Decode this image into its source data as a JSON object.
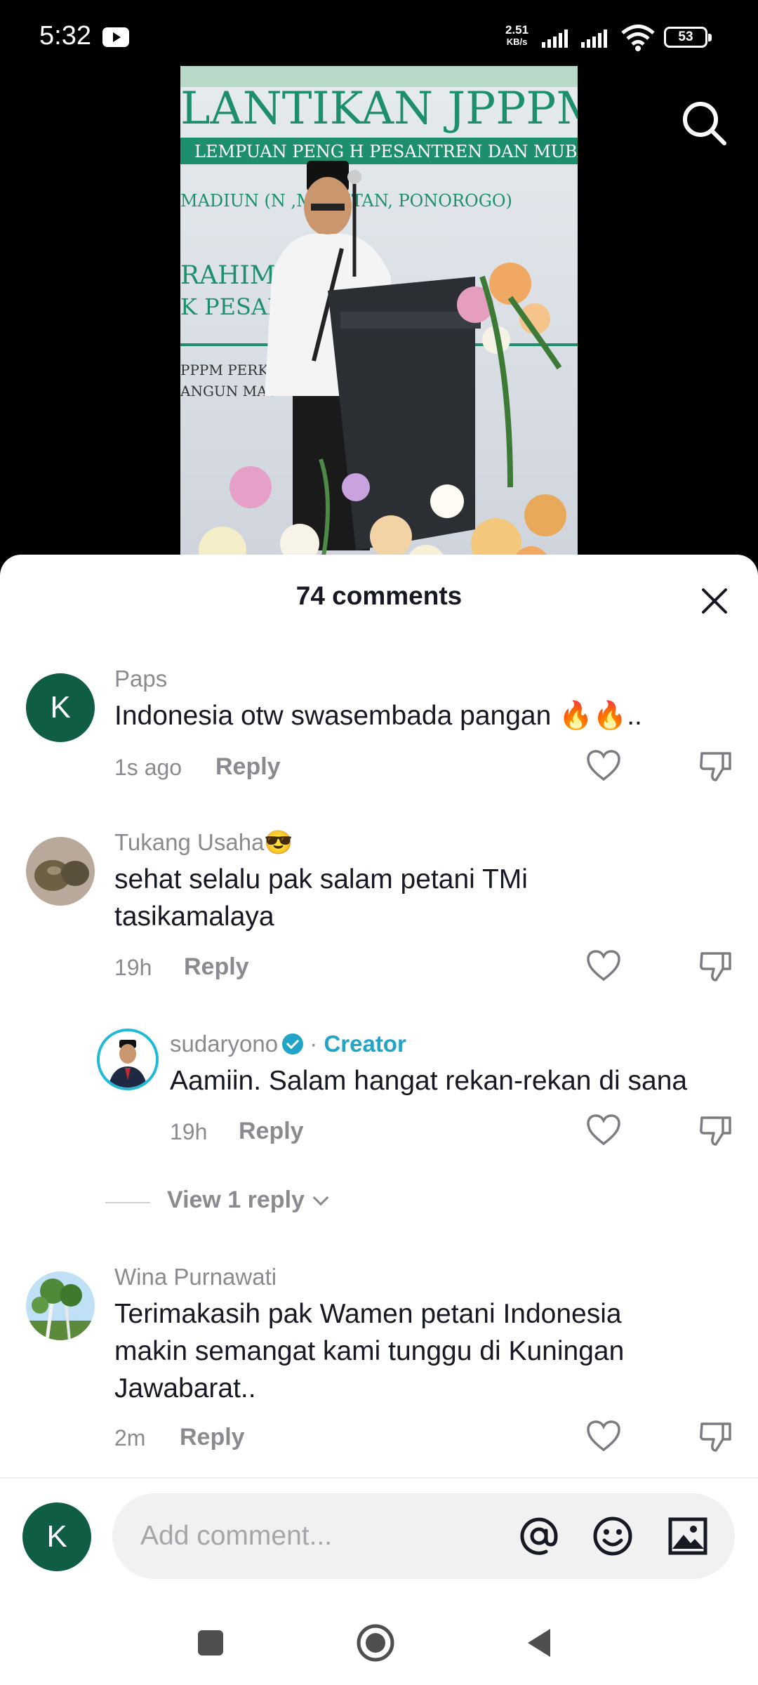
{
  "status_bar": {
    "time": "5:32",
    "net_speed_value": "2.51",
    "net_speed_unit": "KB/s",
    "battery": "53",
    "youtube_icon": "youtube-icon",
    "wifi_icon": "wifi-icon"
  },
  "video": {
    "banner_line1": "LANTIKAN JPPPM",
    "banner_line2": "LEMPUAN PENG    H PESANTREN DAN MUBALI",
    "banner_line3": "MADIUN (N              ,MAGETAN, PONOROGO)",
    "banner_line4": "RAHIM",
    "banner_line5": "K PESANT",
    "banner_line6": "PPPM PERKUAT",
    "banner_line7": "ANGUN MASYAR",
    "search_icon": "search-icon"
  },
  "comments_sheet": {
    "title": "74 comments",
    "close_icon": "close-icon"
  },
  "comments": [
    {
      "username": "Paps",
      "avatar_letter": "K",
      "text": "Indonesia otw swasembada pangan 🔥🔥..",
      "time": "1s ago",
      "reply_label": "Reply"
    },
    {
      "username": "Tukang Usaha😎",
      "text_line1": "sehat selalu pak salam petani TMi",
      "text_line2": "tasikamalaya",
      "time": "19h",
      "reply_label": "Reply"
    },
    {
      "username": "sudaryono",
      "separator": " · ",
      "creator_label": "Creator",
      "text": "Aamiin. Salam hangat rekan-rekan di sana",
      "time": "19h",
      "reply_label": "Reply"
    },
    {
      "username": "Wina Purnawati",
      "text_line1": "Terimakasih pak Wamen petani Indonesia",
      "text_line2": "makin semangat kami tunggu di Kuningan",
      "text_line3": "Jawabarat..",
      "time": "2m",
      "reply_label": "Reply"
    }
  ],
  "view_replies": "View 1 reply",
  "input_bar": {
    "avatar_letter": "K",
    "placeholder": "Add comment...",
    "mention_icon": "at-icon",
    "emoji_icon": "emoji-icon",
    "image_icon": "image-icon"
  },
  "nav": {
    "recents": "square-icon",
    "home": "circle-icon",
    "back": "triangle-icon"
  }
}
